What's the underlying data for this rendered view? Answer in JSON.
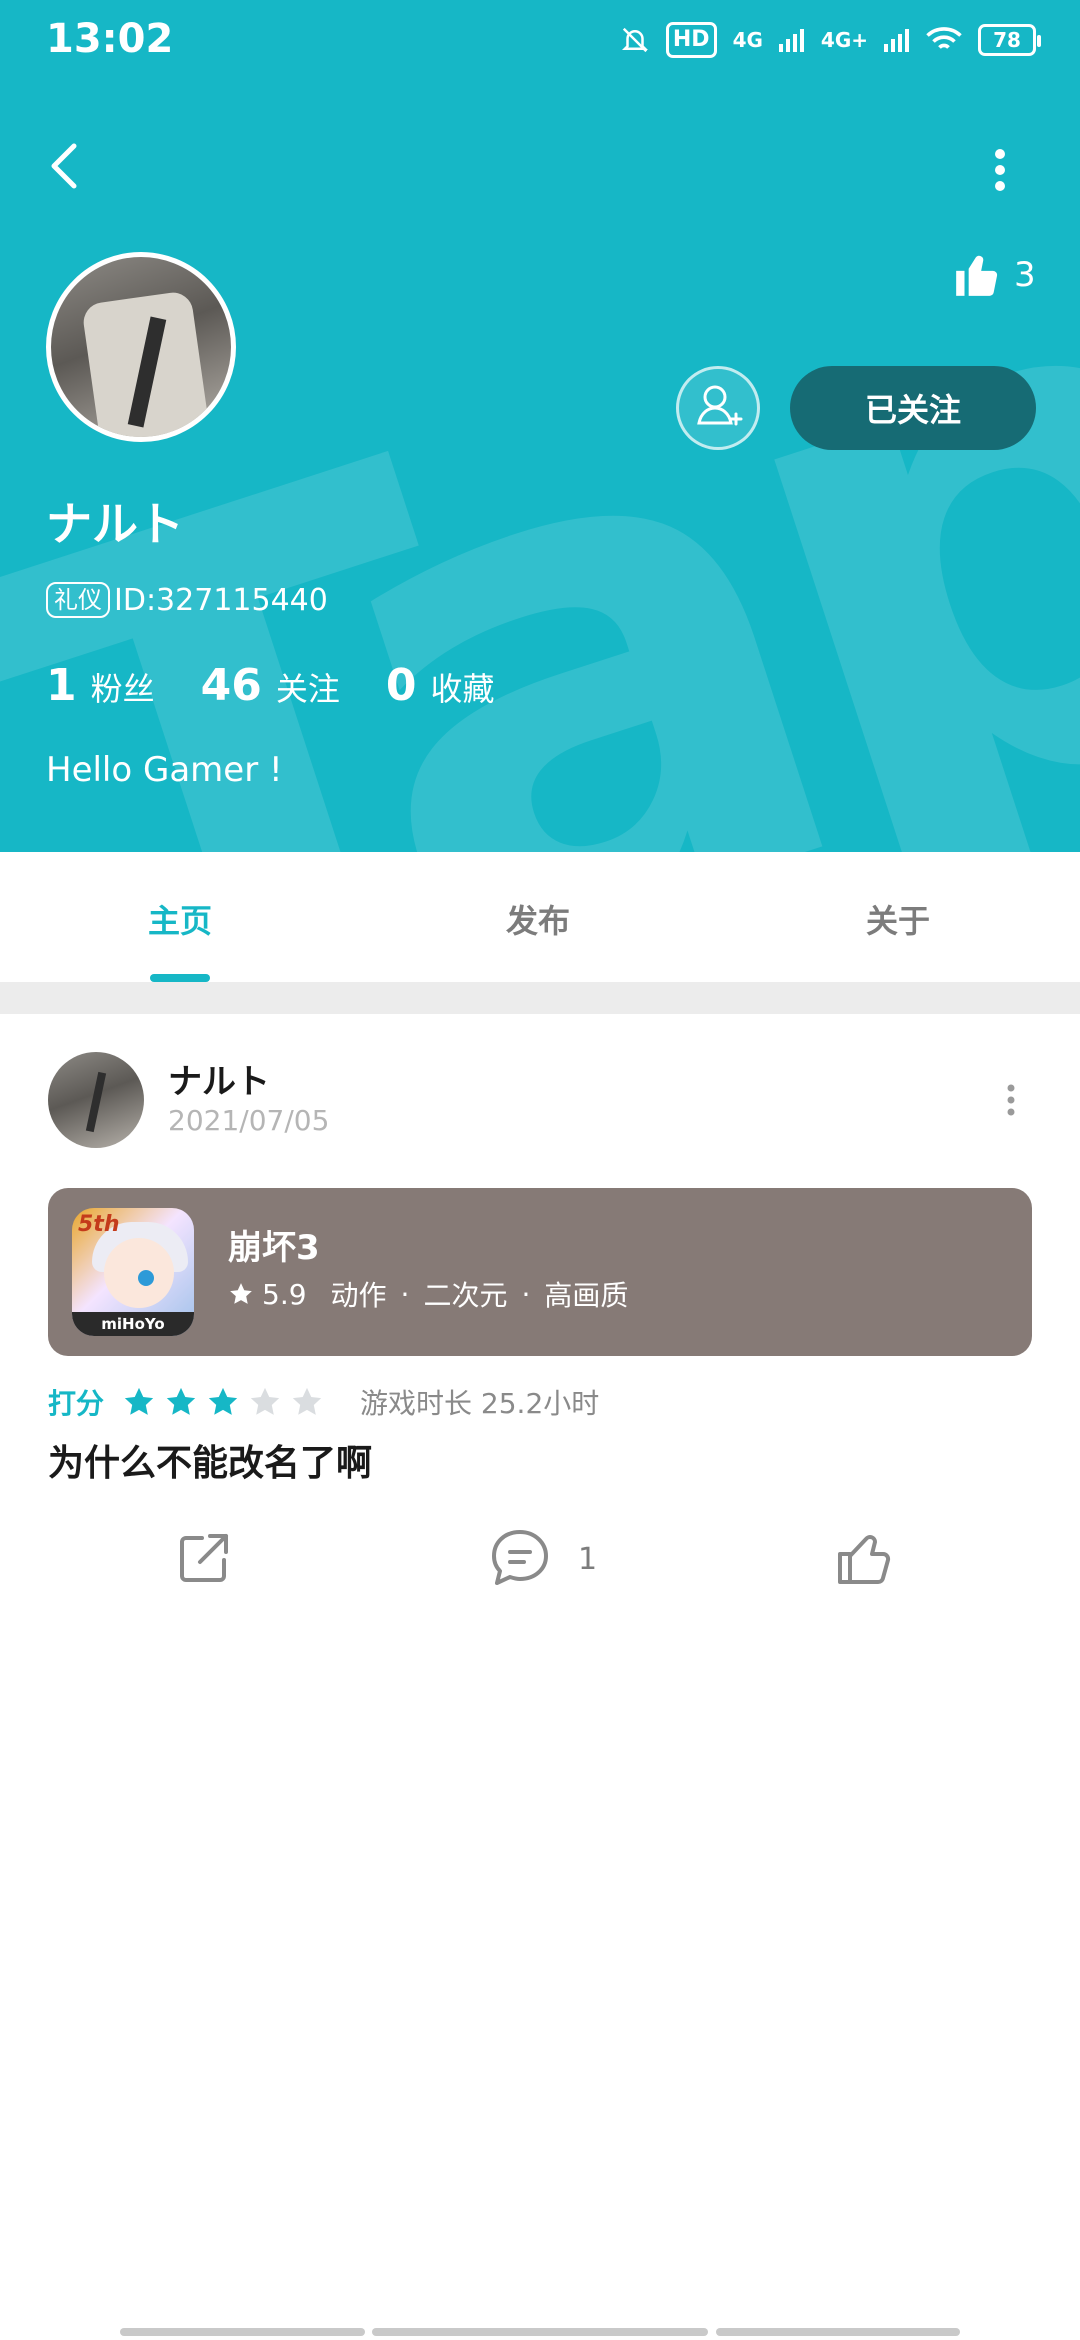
{
  "status_bar": {
    "time": "13:02",
    "hd_label": "HD",
    "net1": "4G",
    "net2": "4G+",
    "battery": "78"
  },
  "header": {
    "bg_color": "#16b7c6",
    "watermark": "TapTap",
    "likes": "3",
    "follow_button": "已关注",
    "username": "ナルト",
    "id_tag": "礼仪",
    "id_text": "ID:327115440",
    "stats": [
      {
        "value": "1",
        "label": "粉丝"
      },
      {
        "value": "46",
        "label": "关注"
      },
      {
        "value": "0",
        "label": "收藏"
      }
    ],
    "bio": "Hello Gamer !"
  },
  "tabs": [
    {
      "label": "主页",
      "active": true
    },
    {
      "label": "发布",
      "active": false
    },
    {
      "label": "关于",
      "active": false
    }
  ],
  "post": {
    "author": "ナルト",
    "date": "2021/07/05",
    "game": {
      "name": "崩坏3",
      "score": "5.9",
      "tags": [
        "动作",
        "二次元",
        "高画质"
      ],
      "icon_badge": "5th",
      "icon_brand": "miHoYo"
    },
    "rating_label": "打分",
    "rating_stars": 3,
    "rating_max": 5,
    "playtime": "游戏时长 25.2小时",
    "text": "为什么不能改名了啊",
    "comment_count": "1"
  }
}
